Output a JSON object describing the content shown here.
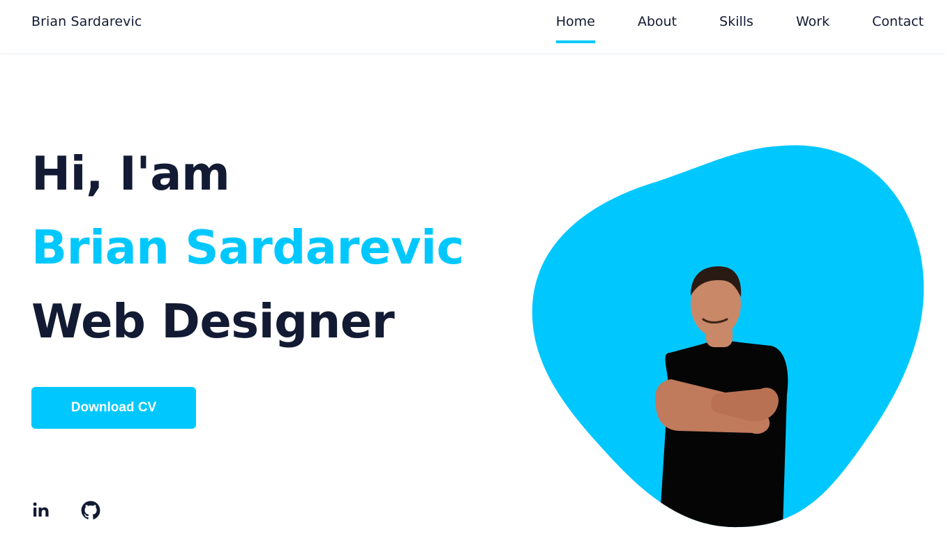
{
  "header": {
    "logo": "Brian Sardarevic",
    "nav": [
      {
        "label": "Home",
        "active": true
      },
      {
        "label": "About",
        "active": false
      },
      {
        "label": "Skills",
        "active": false
      },
      {
        "label": "Work",
        "active": false
      },
      {
        "label": "Contact",
        "active": false
      }
    ]
  },
  "hero": {
    "greeting": "Hi, I'am",
    "name": "Brian Sardarevic",
    "role": "Web Designer",
    "cta_label": "Download CV"
  },
  "social": [
    {
      "icon": "linkedin-icon"
    },
    {
      "icon": "github-icon"
    }
  ],
  "colors": {
    "accent": "#00c8ff",
    "text": "#121b33",
    "background": "#ffffff"
  }
}
